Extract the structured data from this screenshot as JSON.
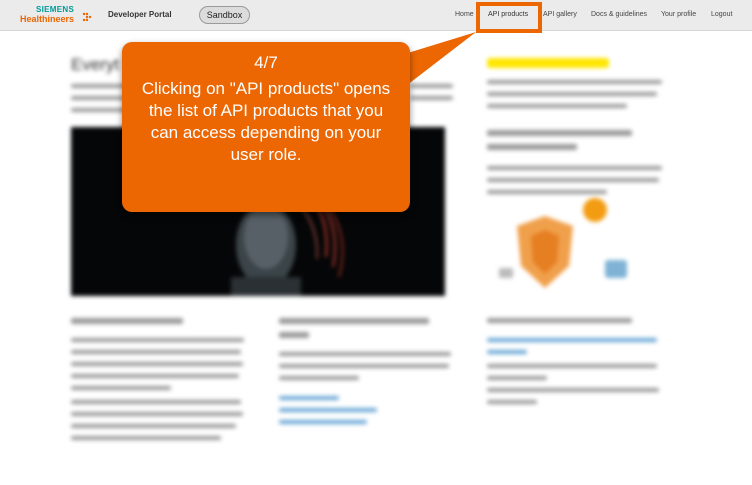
{
  "header": {
    "logo_line1": "SIEMENS",
    "logo_line2": "Healthineers",
    "portal_title": "Developer Portal",
    "sandbox_label": "Sandbox",
    "nav": {
      "home": "Home",
      "api_products": "API products",
      "api_gallery": "API gallery",
      "docs": "Docs & guidelines",
      "profile": "Your profile",
      "logout": "Logout"
    }
  },
  "main": {
    "heading": "Everyt"
  },
  "callout": {
    "step": "4/7",
    "text": "Clicking on \"API products\" opens the list of API products that you can access depending on your user role."
  },
  "colors": {
    "accent": "#ec6602",
    "brand_teal": "#009999",
    "nav_bg": "#ebebeb",
    "highlight_yellow": "#ffe600"
  }
}
